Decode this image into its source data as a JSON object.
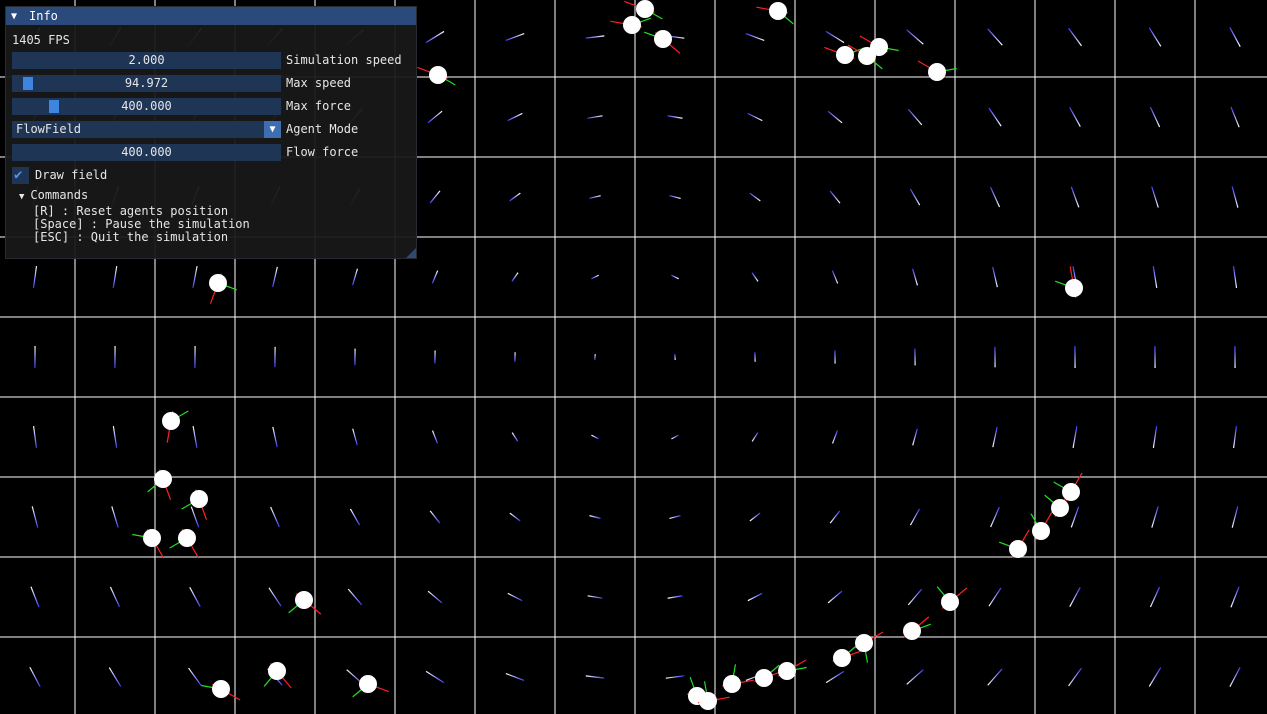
{
  "window": {
    "title": "Info",
    "fps_text": "1405 FPS",
    "sliders": [
      {
        "value": "2.000",
        "label": "Simulation speed"
      },
      {
        "value": "94.972",
        "label": "Max speed",
        "fill_fraction": 0.05
      },
      {
        "value": "400.000",
        "label": "Max force",
        "fill_fraction": 0.15
      },
      {
        "value": "400.000",
        "label": "Flow force"
      }
    ],
    "agent_mode": {
      "value": "FlowField",
      "label": "Agent Mode"
    },
    "draw_field": {
      "label": "Draw field",
      "checked": true
    },
    "commands": {
      "header": "Commands",
      "lines": [
        "[R] : Reset agents position",
        "[Space] : Pause the simulation",
        "[ESC] : Quit the simulation"
      ]
    }
  },
  "colors": {
    "background": "#000000",
    "grid": "#ffffff",
    "field_vector": "#3b3bff",
    "agent": "#ffffff",
    "velocity": "#ff2020",
    "force": "#20e020",
    "title_bar": "#294a7a",
    "frame": "#1f3556",
    "slider_grab": "#3d85e0"
  }
}
